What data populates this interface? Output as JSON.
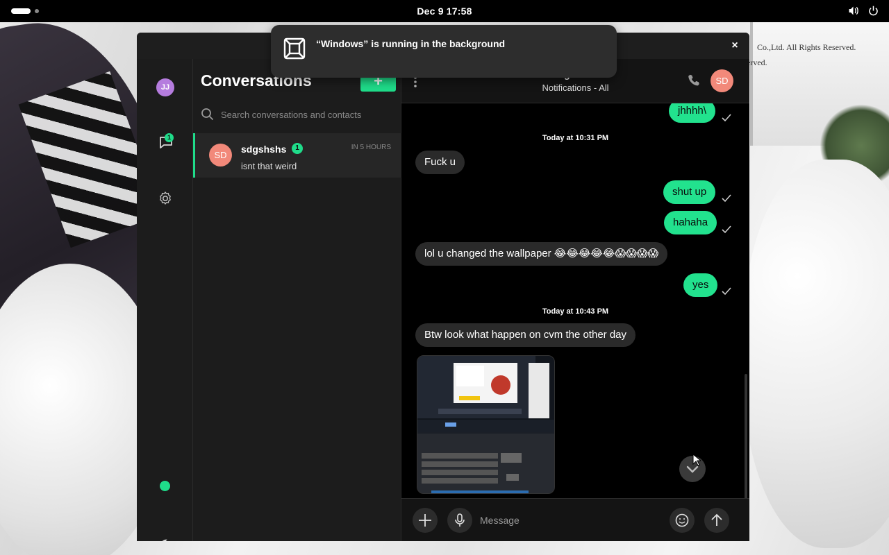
{
  "topbar": {
    "clock": "Dec 9  17:58",
    "icons": [
      "activities-indicator",
      "volume-icon",
      "power-icon"
    ]
  },
  "wallpaper": {
    "text_line1": "Co.,Ltd. All Rights Reserved.",
    "text_line2": "erved."
  },
  "notification": {
    "text": "“Windows” is running in the background",
    "icon": "app-window-icon"
  },
  "window": {
    "close_label": "×"
  },
  "rail": {
    "avatar_initials": "JJ",
    "avatar_color": "#b57cde",
    "chat_badge": "1",
    "status_color": "#1fdc8a",
    "icons": [
      "chat-icon",
      "gear-icon",
      "moon-icon"
    ]
  },
  "conversations": {
    "title": "Conversations",
    "new_label": "+",
    "search_placeholder": "Search conversations and contacts",
    "items": [
      {
        "initials": "SD",
        "name": "sdgshshs",
        "unread": "1",
        "time": "IN 5 HOURS",
        "preview": "isnt that weird"
      }
    ]
  },
  "chat": {
    "contact_name": "sdgshshs",
    "subtitle": "Notifications - All",
    "avatar_initials": "SD",
    "accent": "#22e28e",
    "messages": [
      {
        "type": "out",
        "text": "jhhhh\\"
      },
      {
        "type": "day",
        "text": "Today at 10:31 PM"
      },
      {
        "type": "in",
        "text": "Fuck u"
      },
      {
        "type": "out",
        "text": "shut up"
      },
      {
        "type": "out",
        "text": "hahaha"
      },
      {
        "type": "in",
        "text": "lol u changed the wallpaper 😂😂😂😂😂😱😱😱😱"
      },
      {
        "type": "out",
        "text": "yes"
      },
      {
        "type": "day",
        "text": "Today at 10:43 PM"
      },
      {
        "type": "in",
        "text": "Btw look what happen on cvm the other day"
      }
    ],
    "image_message": "screenshot-thumbnail",
    "composer_placeholder": "Message"
  }
}
